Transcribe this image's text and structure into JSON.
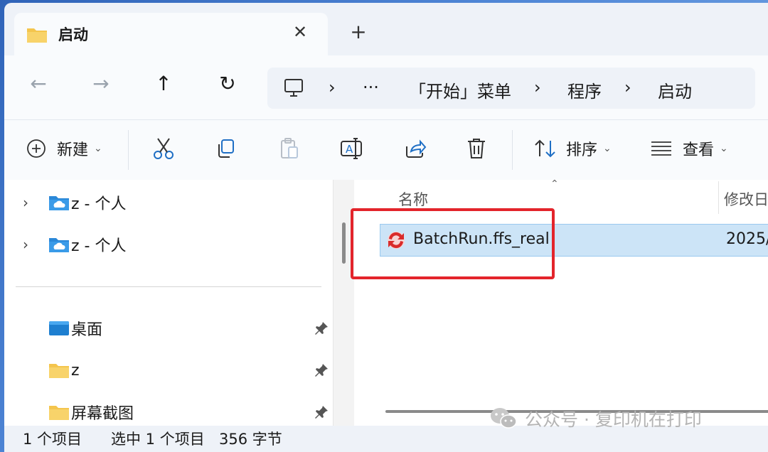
{
  "tab": {
    "title": "启动",
    "close": "✕",
    "new_tab": "+"
  },
  "nav": {
    "back": "←",
    "forward": "→",
    "up": "↑",
    "refresh": "↻"
  },
  "address": {
    "parts": [
      "›",
      "···",
      "›",
      "「开始」菜单",
      "›",
      "程序",
      "›",
      "启动"
    ]
  },
  "toolbar": {
    "new_label": "新建",
    "sort_label": "排序",
    "view_label": "查看",
    "chevron": "⌄"
  },
  "sidebar": {
    "cloud_items": [
      {
        "label": "z - 个人",
        "expander": "›"
      },
      {
        "label": "z - 个人",
        "expander": "›"
      }
    ],
    "quick_items": [
      {
        "label": "桌面",
        "icon": "desktop-folder-icon"
      },
      {
        "label": "z",
        "icon": "folder-icon"
      },
      {
        "label": "屏幕截图",
        "icon": "folder-icon"
      }
    ]
  },
  "columns": {
    "name": "名称",
    "modified": "修改日"
  },
  "files": [
    {
      "name": "BatchRun.ffs_real",
      "modified": "2025/",
      "selected": true
    }
  ],
  "status": {
    "count": "1 个项目",
    "selected": "选中 1 个项目",
    "size": "356 字节"
  },
  "watermark": "公众号 · 复印机在打印",
  "colors": {
    "highlight": "#e3242b",
    "selection": "#cce4f7",
    "folder": "#f4c54d"
  }
}
